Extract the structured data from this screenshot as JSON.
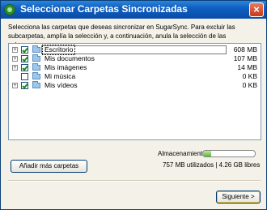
{
  "window": {
    "title": "Seleccionar Carpetas Sincronizadas",
    "close_symbol": "×"
  },
  "description": "Selecciona las carpetas que deseas sincronizar en SugarSync. Para excluir las subcarpetas, amplía la selección y, a continuación, anula la selección de las subcarpetas.",
  "folders": [
    {
      "name": "Escritorio",
      "size": "608 MB",
      "checked": true,
      "expandable": true,
      "selected": true
    },
    {
      "name": "Mis documentos",
      "size": "107 MB",
      "checked": true,
      "expandable": true,
      "selected": false
    },
    {
      "name": "Mis imágenes",
      "size": "14 MB",
      "checked": true,
      "expandable": true,
      "selected": false
    },
    {
      "name": "Mi música",
      "size": "0 KB",
      "checked": false,
      "expandable": false,
      "selected": false
    },
    {
      "name": "Mis vídeos",
      "size": "0 KB",
      "checked": true,
      "expandable": true,
      "selected": false
    }
  ],
  "expander_symbol": "+",
  "buttons": {
    "add_folders": "Añadir más carpetas",
    "next": "Siguiente >"
  },
  "storage": {
    "label": "Almacenamiento:",
    "usage_text": "757 MB utilizados | 4.26 GB libres",
    "used_fraction": 0.15,
    "bar_color": "#5cb531"
  },
  "icons": {
    "app": "sugarsync-logo-icon",
    "folder": "folder-icon",
    "close": "close-icon"
  }
}
